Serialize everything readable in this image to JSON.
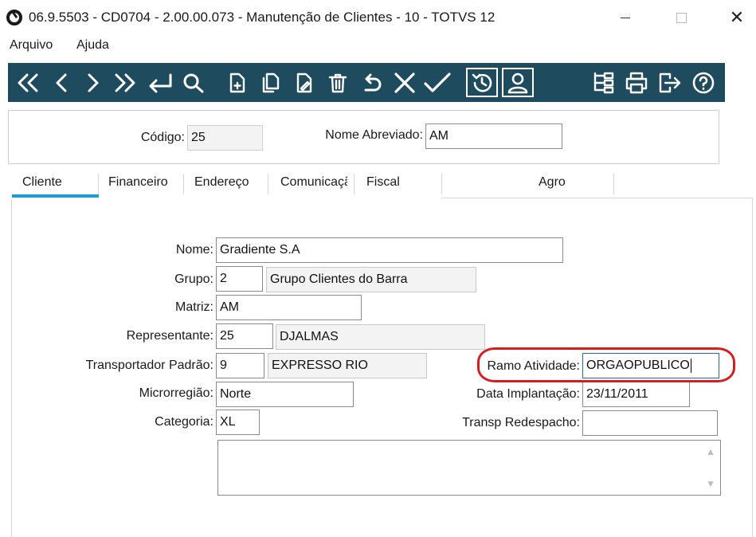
{
  "window": {
    "title": "06.9.5503 - CD0704 - 2.00.00.073 - Manutenção de Clientes - 10 - TOTVS 12",
    "minimize_glyph": "—",
    "maximize_glyph": "☐",
    "close_glyph": "✕"
  },
  "menu": {
    "items": [
      "Arquivo",
      "Ajuda"
    ]
  },
  "toolbar": {
    "background": "#1f4b5f",
    "buttons": [
      "first-record-icon",
      "previous-record-icon",
      "next-record-icon",
      "last-record-icon",
      "goto-icon",
      "search-icon",
      "new-record-icon",
      "copy-icon",
      "edit-icon",
      "delete-icon",
      "undo-icon",
      "cancel-icon",
      "confirm-icon",
      "history-icon",
      "user-icon",
      "tree-icon",
      "print-icon",
      "exit-icon",
      "help-icon"
    ]
  },
  "header": {
    "codigo_label": "Código:",
    "codigo_value": "25",
    "nome_abreviado_label": "Nome Abreviado:",
    "nome_abreviado_value": "AM"
  },
  "tabs": [
    {
      "label": "Cliente",
      "active": true
    },
    {
      "label": "Financeiro",
      "active": false
    },
    {
      "label": "Endereço",
      "active": false
    },
    {
      "label": "Comunicaçã",
      "active": false
    },
    {
      "label": "Fiscal",
      "active": false
    },
    {
      "label": "Agro",
      "active": false
    }
  ],
  "form": {
    "nome": {
      "label": "Nome:",
      "value": "Gradiente S.A"
    },
    "grupo": {
      "label": "Grupo:",
      "code": "2",
      "description": "Grupo Clientes do Barra"
    },
    "matriz": {
      "label": "Matriz:",
      "value": "AM"
    },
    "representante": {
      "label": "Representante:",
      "code": "25",
      "description": "DJALMAS"
    },
    "transportador": {
      "label": "Transportador Padrão:",
      "code": "9",
      "description": "EXPRESSO RIO"
    },
    "microrregiao": {
      "label": "Microrregião:",
      "value": "Norte"
    },
    "categoria": {
      "label": "Categoria:",
      "value": "XL"
    },
    "ramo_atividade": {
      "label": "Ramo Atividade:",
      "value": "ORGAOPUBLICO"
    },
    "data_implantacao": {
      "label": "Data Implantação:",
      "value": "23/11/2011"
    },
    "transp_redespacho": {
      "label": "Transp Redespacho:",
      "value": ""
    },
    "observacao": {
      "value": ""
    }
  },
  "colors": {
    "accent": "#1a9ad6",
    "highlight": "#d61e1e",
    "toolbar": "#1f4b5f"
  }
}
